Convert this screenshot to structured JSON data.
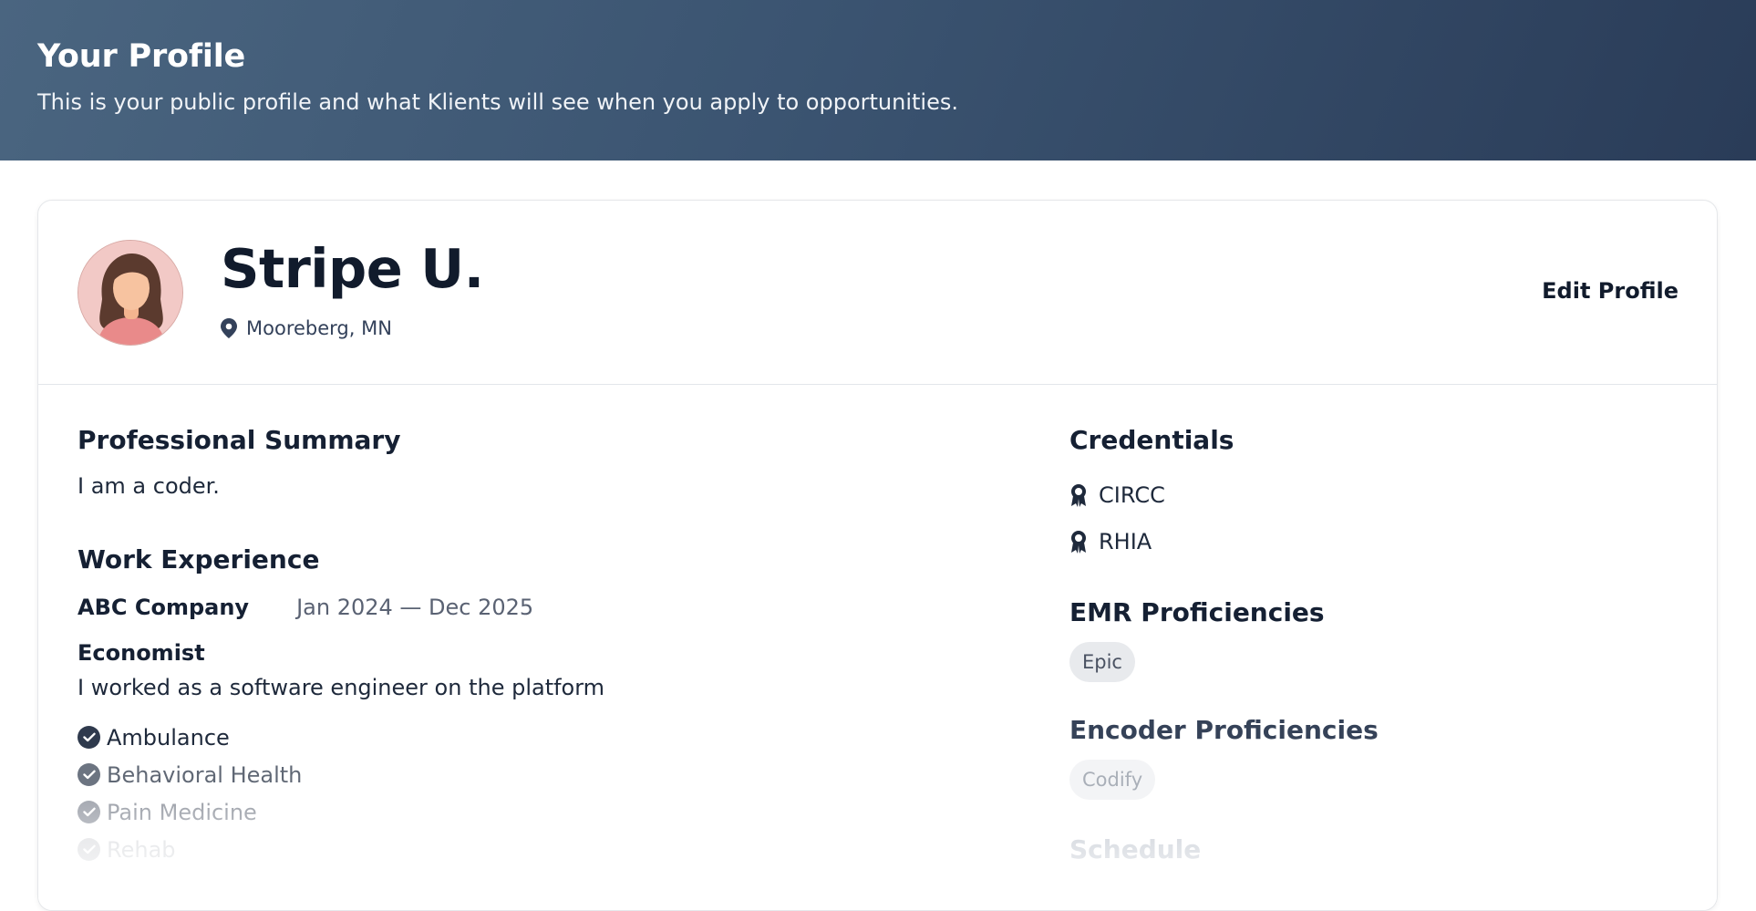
{
  "header": {
    "title": "Your Profile",
    "subtitle": "This is your public profile and what Klients will see when you apply to opportunities."
  },
  "profile": {
    "name": "Stripe U.",
    "location": "Mooreberg, MN",
    "edit_label": "Edit Profile"
  },
  "summary": {
    "heading": "Professional Summary",
    "text": "I am a coder."
  },
  "work": {
    "heading": "Work Experience",
    "items": [
      {
        "company": "ABC Company",
        "dates": "Jan 2024 — Dec 2025",
        "role": "Economist",
        "description": "I worked as a software engineer on the platform",
        "specialties": [
          "Ambulance",
          "Behavioral Health",
          "Pain Medicine",
          "Rehab"
        ]
      }
    ]
  },
  "credentials": {
    "heading": "Credentials",
    "items": [
      "CIRCC",
      "RHIA"
    ]
  },
  "emr": {
    "heading": "EMR Proficiencies",
    "items": [
      "Epic"
    ]
  },
  "encoder": {
    "heading": "Encoder Proficiencies",
    "items": [
      "Codify"
    ]
  },
  "schedule": {
    "heading": "Schedule"
  },
  "colors": {
    "hero_start": "#4a6580",
    "hero_end": "#2a3c58",
    "text_dark": "#111b2c",
    "check": "#2f3a4d"
  }
}
